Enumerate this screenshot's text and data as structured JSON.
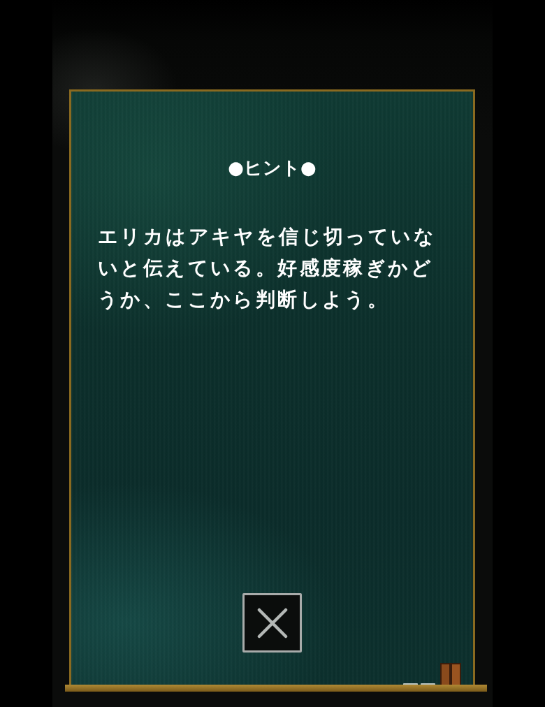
{
  "hint": {
    "title": "●ヒント●",
    "text": "エリカはアキヤを信じ切っていないと伝えている。好感度稼ぎかどうか、ここから判断しよう。"
  }
}
